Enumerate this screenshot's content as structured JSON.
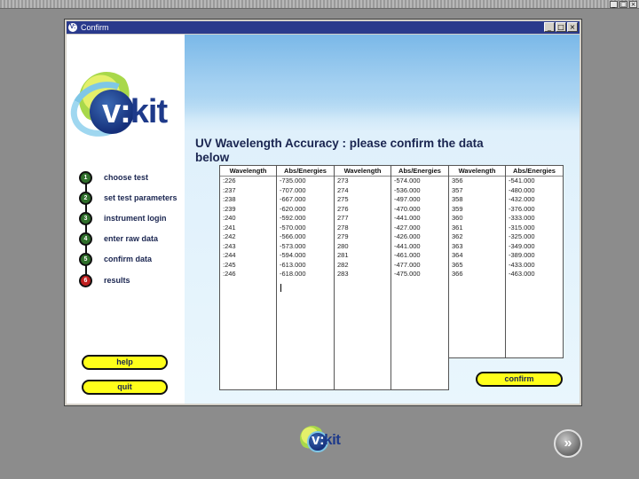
{
  "window": {
    "title": "Confirm",
    "title_icon": "V:",
    "minimize": "_",
    "maximize": "□",
    "close": "×"
  },
  "host_controls": [
    "_",
    "□",
    "×"
  ],
  "logo": {
    "v": "v:",
    "kit": "kit"
  },
  "heading": "UV Wavelength Accuracy : please confirm the data below",
  "steps": [
    {
      "num": "1",
      "label": "choose test",
      "status": "done"
    },
    {
      "num": "2",
      "label": "set test parameters",
      "status": "done"
    },
    {
      "num": "3",
      "label": "instrument login",
      "status": "done"
    },
    {
      "num": "4",
      "label": "enter raw data",
      "status": "done"
    },
    {
      "num": "5",
      "label": "confirm data",
      "status": "current"
    },
    {
      "num": "6",
      "label": "results",
      "status": "pending"
    }
  ],
  "buttons": {
    "help": "help",
    "quit": "quit",
    "confirm": "confirm"
  },
  "tables": [
    {
      "headers": [
        "Wavelength",
        "Abs/Energies"
      ],
      "rows": [
        [
          ":226",
          "-735.000"
        ],
        [
          ":237",
          "-707.000"
        ],
        [
          ":238",
          "-667.000"
        ],
        [
          ":239",
          "-620.000"
        ],
        [
          ":240",
          "-592.000"
        ],
        [
          ":241",
          "-570.000"
        ],
        [
          ":242",
          "-566.000"
        ],
        [
          ":243",
          "-573.000"
        ],
        [
          ":244",
          "-594.000"
        ],
        [
          ":245",
          "-613.000"
        ],
        [
          ":246",
          "-618.000"
        ]
      ]
    },
    {
      "headers": [
        "Wavelength",
        "Abs/Energies"
      ],
      "rows": [
        [
          "273",
          "-574.000"
        ],
        [
          "274",
          "-536.000"
        ],
        [
          "275",
          "-497.000"
        ],
        [
          "276",
          "-470.000"
        ],
        [
          "277",
          "-441.000"
        ],
        [
          "278",
          "-427.000"
        ],
        [
          "279",
          "-426.000"
        ],
        [
          "280",
          "-441.000"
        ],
        [
          "281",
          "-461.000"
        ],
        [
          "282",
          "-477.000"
        ],
        [
          "283",
          "-475.000"
        ]
      ]
    },
    {
      "headers": [
        "Wavelength",
        "Abs/Energies"
      ],
      "rows": [
        [
          "356",
          "-541.000"
        ],
        [
          "357",
          "-480.000"
        ],
        [
          "358",
          "-432.000"
        ],
        [
          "359",
          "-376.000"
        ],
        [
          "360",
          "-333.000"
        ],
        [
          "361",
          "-315.000"
        ],
        [
          "362",
          "-325.000"
        ],
        [
          "363",
          "-349.000"
        ],
        [
          "364",
          "-389.000"
        ],
        [
          "365",
          "-433.000"
        ],
        [
          "366",
          "-463.000"
        ]
      ]
    }
  ],
  "footer": {
    "logo_v": "v:",
    "logo_kit": "kit",
    "next_icon": "»"
  },
  "colors": {
    "accent_button": "#ffff1a",
    "step_done": "#2f6e2a",
    "step_pending": "#c02020",
    "title_bar": "#2a3a8c",
    "text_dark": "#1a2550"
  }
}
